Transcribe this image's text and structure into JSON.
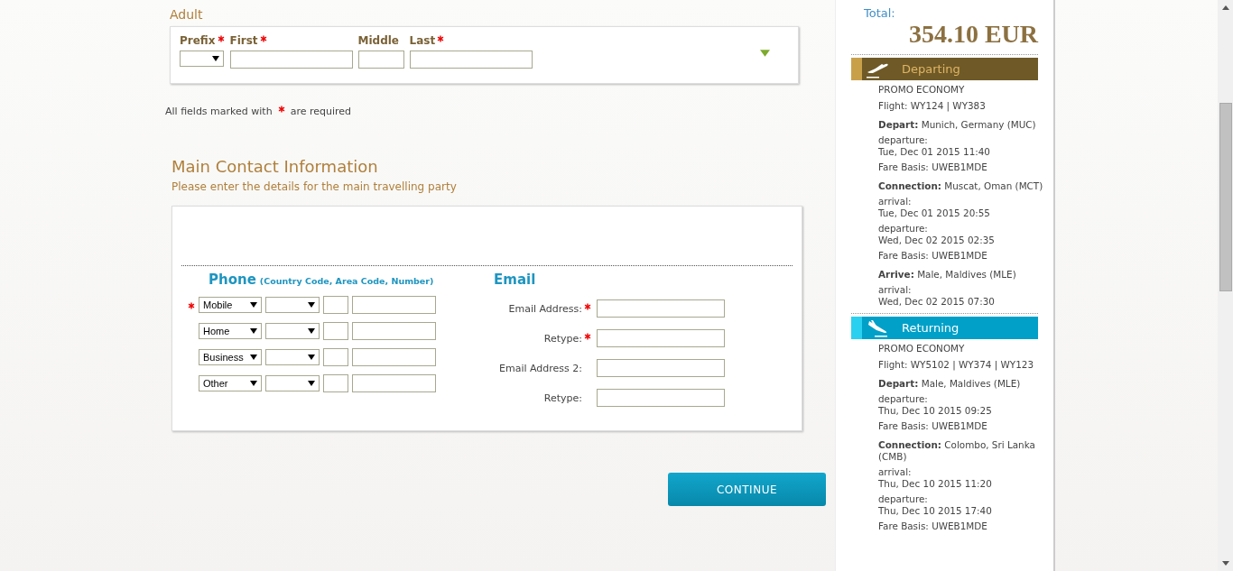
{
  "adult": {
    "title": "Adult",
    "fields": [
      {
        "label": "Prefix",
        "required": true,
        "kind": "select"
      },
      {
        "label": "First",
        "required": true,
        "kind": "text"
      },
      {
        "label": "Middle",
        "required": false,
        "kind": "text"
      },
      {
        "label": "Last",
        "required": true,
        "kind": "text"
      }
    ],
    "expanded": false
  },
  "required_note": {
    "before": "All fields marked with",
    "after": "are required"
  },
  "contact": {
    "title": "Main Contact Information",
    "subtitle": "Please enter the details for the main travelling party",
    "phone": {
      "title": "Phone",
      "hint": "(Country Code, Area Code, Number)",
      "rows": [
        {
          "type": "Mobile",
          "required": true
        },
        {
          "type": "Home",
          "required": false
        },
        {
          "type": "Business",
          "required": false
        },
        {
          "type": "Other",
          "required": false
        }
      ]
    },
    "email": {
      "title": "Email",
      "rows": [
        {
          "label": "Email Address:",
          "required": true
        },
        {
          "label": "Retype:",
          "required": true
        },
        {
          "label": "Email Address 2:",
          "required": false
        },
        {
          "label": "Retype:",
          "required": false
        }
      ]
    }
  },
  "continue_button": "CONTINUE",
  "summary": {
    "total_label": "Total:",
    "total": "354.10 EUR",
    "legs": [
      {
        "title": "Departing",
        "kind": "departing",
        "cabin": "PROMO ECONOMY",
        "flight": "Flight: WY124 | WY383",
        "stops": [
          {
            "place": "**Depart:** Munich, Germany (MUC)",
            "times": [
              {
                "label": "departure:",
                "time": "Tue, Dec 01 2015 11:40"
              }
            ],
            "fare": "Fare Basis: UWEB1MDE"
          },
          {
            "place": "**Connection:** Muscat, Oman (MCT)",
            "times": [
              {
                "label": "arrival:",
                "time": "Tue, Dec 01 2015 20:55"
              },
              {
                "label": "departure:",
                "time": "Wed, Dec 02 2015 02:35"
              }
            ],
            "fare": "Fare Basis: UWEB1MDE"
          },
          {
            "place": "**Arrive:** Male, Maldives (MLE)",
            "times": [
              {
                "label": "arrival:",
                "time": "Wed, Dec 02 2015 07:30"
              }
            ]
          }
        ]
      },
      {
        "title": "Returning",
        "kind": "returning",
        "cabin": "PROMO ECONOMY",
        "flight": "Flight: WY5102 | WY374 | WY123",
        "stops": [
          {
            "place": "**Depart:** Male, Maldives (MLE)",
            "times": [
              {
                "label": "departure:",
                "time": "Thu, Dec 10 2015 09:25"
              }
            ],
            "fare": "Fare Basis: UWEB1MDE"
          },
          {
            "place": "**Connection:** Colombo, Sri Lanka (CMB)",
            "times": [
              {
                "label": "arrival:",
                "time": "Thu, Dec 10 2015 11:20"
              },
              {
                "label": "departure:",
                "time": "Thu, Dec 10 2015 17:40"
              }
            ],
            "fare": "Fare Basis: UWEB1MDE"
          }
        ]
      }
    ]
  }
}
